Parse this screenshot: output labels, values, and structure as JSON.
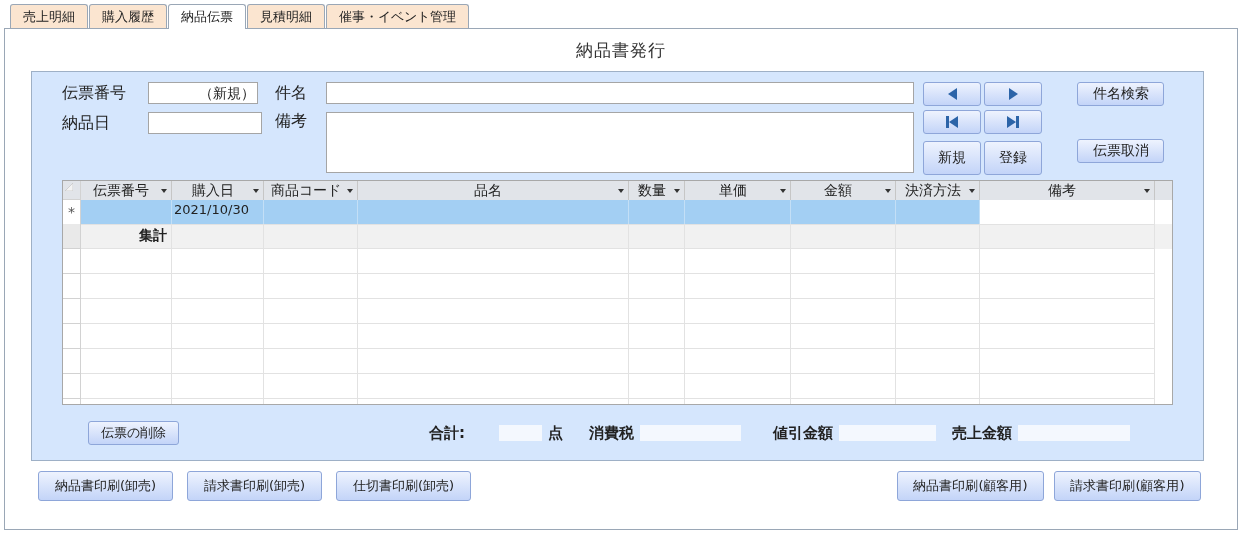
{
  "tabs": [
    {
      "label": "売上明細",
      "selected": false
    },
    {
      "label": "購入履歴",
      "selected": false
    },
    {
      "label": "納品伝票",
      "selected": true
    },
    {
      "label": "見積明細",
      "selected": false
    },
    {
      "label": "催事・イベント管理",
      "selected": false
    }
  ],
  "title": "納品書発行",
  "form": {
    "slip_no": {
      "label": "伝票番号",
      "value": "（新規）"
    },
    "delivery_date": {
      "label": "納品日"
    },
    "subject": {
      "label": "件名"
    },
    "memo": {
      "label": "備考"
    }
  },
  "nav_buttons": [
    {
      "kind": "prev"
    },
    {
      "kind": "next"
    },
    {
      "kind": "first"
    },
    {
      "kind": "last"
    }
  ],
  "record_buttons": [
    "新規",
    "登録"
  ],
  "side_buttons": [
    "件名検索",
    "伝票取消"
  ],
  "grid": {
    "columns": [
      "伝票番号",
      "購入日",
      "商品コード",
      "品名",
      "数量",
      "単価",
      "金額",
      "決済方法",
      "備考"
    ],
    "new_row": {
      "marker": "*",
      "selected": true,
      "cells": [
        "",
        "2021/10/30",
        "",
        "",
        "",
        "",
        "",
        "",
        ""
      ]
    },
    "summary_row": {
      "label": "集計"
    }
  },
  "delete_button": "伝票の削除",
  "totals": [
    {
      "kind": "label",
      "text": "合計:"
    },
    {
      "kind": "field"
    },
    {
      "kind": "label",
      "text": "点"
    },
    {
      "kind": "label",
      "text": "消費税"
    },
    {
      "kind": "field"
    },
    {
      "kind": "label",
      "text": "値引金額"
    },
    {
      "kind": "field"
    },
    {
      "kind": "label",
      "text": "売上金額"
    },
    {
      "kind": "field"
    }
  ],
  "print_buttons_left": [
    "納品書印刷(卸売)",
    "請求書印刷(卸売)",
    "仕切書印刷(卸売)"
  ],
  "print_buttons_right": [
    "納品書印刷(顧客用)",
    "請求書印刷(顧客用)"
  ]
}
